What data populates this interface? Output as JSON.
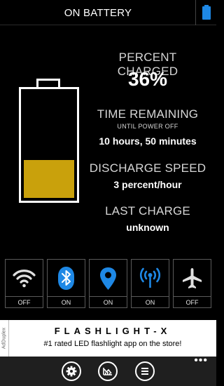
{
  "header": {
    "title": "ON BATTERY",
    "battery_icon": "battery-icon"
  },
  "battery": {
    "percent": 0.36,
    "fill_color": "#c9a10c"
  },
  "stats": {
    "percent_label": "PERCENT CHARGED",
    "percent_value": "36%",
    "time_label": "TIME REMAINING",
    "time_sublabel": "UNTIL POWER OFF",
    "time_value": "10 hours, 50 minutes",
    "discharge_label": "DISCHARGE SPEED",
    "discharge_value": "3 percent/hour",
    "last_charge_label": "LAST CHARGE",
    "last_charge_value": "unknown"
  },
  "toggles": [
    {
      "icon": "wifi-icon",
      "state": "OFF"
    },
    {
      "icon": "bluetooth-icon",
      "state": "ON"
    },
    {
      "icon": "location-pin-icon",
      "state": "ON"
    },
    {
      "icon": "cellular-antenna-icon",
      "state": "ON"
    },
    {
      "icon": "airplane-icon",
      "state": "OFF"
    }
  ],
  "ad": {
    "tag": "AdDuplex",
    "title": "FLASHLIGHT-X",
    "text": "#1 rated LED flashlight app on the store!"
  },
  "app_bar": {
    "buttons": [
      "settings-icon",
      "usage-chart-icon",
      "list-icon"
    ],
    "more": "•••"
  },
  "colors": {
    "accent": "#1e88e5",
    "on": "#1e88e5",
    "off": "#e0e0e0",
    "battery": "#c9a10c"
  }
}
